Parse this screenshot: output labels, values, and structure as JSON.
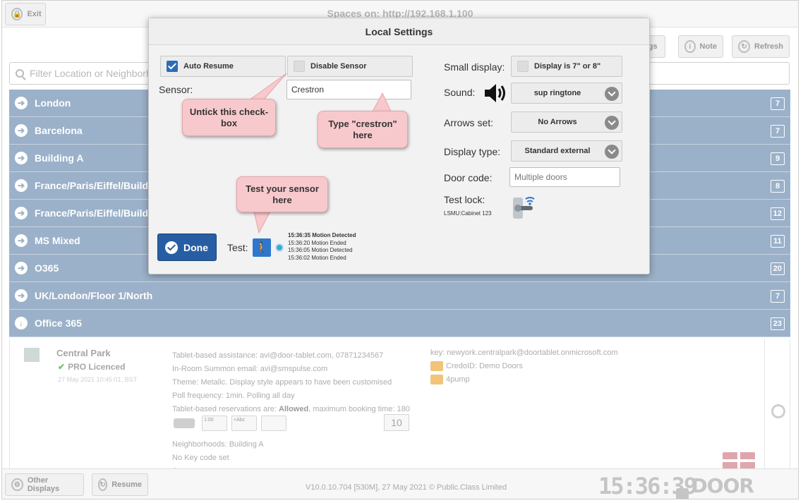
{
  "topbar": {
    "exit_label": "Exit",
    "title": "Spaces on: http://192.168.1.100",
    "settings_label": "ngs",
    "note_label": "Note",
    "refresh_label": "Refresh"
  },
  "filter": {
    "placeholder": "Filter Location or Neighborh"
  },
  "locations": [
    {
      "name": "London",
      "count": "7"
    },
    {
      "name": "Barcelona",
      "count": "7"
    },
    {
      "name": "Building A",
      "count": "9"
    },
    {
      "name": "France/Paris/Eiffel/Buildi",
      "count": "8"
    },
    {
      "name": "France/Paris/Eiffel/Buildi",
      "count": "12"
    },
    {
      "name": "MS Mixed",
      "count": "11"
    },
    {
      "name": "O365",
      "count": "20"
    },
    {
      "name": "UK/London/Floor 1/North",
      "count": "7"
    },
    {
      "name": "Office 365",
      "count": "23"
    }
  ],
  "detail": {
    "name": "Central Park",
    "licence": "PRO Licenced",
    "timestamp": "27 May 2021 10:45:01, BST",
    "line1": "Tablet-based assistance: avi@door-tablet.com, 07871234567",
    "line2": "In-Room Summon email: avi@smspulse.com",
    "line3": "Theme: Metalic. Display style appears to have been customised",
    "line4": "Poll frequency: 1min. Polling all day",
    "line5_prefix": "Tablet-based reservations are: ",
    "line5_bold": "Allowed",
    "line5_suffix": ", maximum booking time: 180",
    "key": "key: newyork.centralpark@doortablet.onmicrosoft.com",
    "credo": "CredoID: Demo Doors",
    "pump": "4pump",
    "dev2": "1:00",
    "dev3": "+Abc",
    "capacity": "10",
    "neighborhoods": "Neighborhoods: Building A",
    "keycode": "No Key code set",
    "cut": "Crestron"
  },
  "bottombar": {
    "other_displays": "Other Displays",
    "resume": "Resume",
    "version": "V10.0.10.704 [530M], 27 May 2021 © Public.Class Limited",
    "clock": "15:36:39",
    "brand": "DOOR TABLET"
  },
  "modal": {
    "title": "Local Settings",
    "auto_resume": "Auto Resume",
    "disable_sensor": "Disable Sensor",
    "sensor_label": "Sensor:",
    "sensor_value": "Crestron",
    "small_display_label": "Small display:",
    "small_display_option": "Display is 7\" or 8\"",
    "sound_label": "Sound:",
    "sound_value": "sup ringtone",
    "arrows_label": "Arrows set:",
    "arrows_value": "No Arrows",
    "display_type_label": "Display type:",
    "display_type_value": "Standard external",
    "door_code_label": "Door code:",
    "door_code_placeholder": "Multiple doors",
    "test_lock_label": "Test lock:",
    "test_lock_sub": "LSMU:Cabinet 123",
    "done_label": "Done",
    "test_label": "Test:",
    "log": [
      "15:36:35 Motion Detected",
      "15:36:20 Motion Ended",
      "15:36:05 Motion Detected",
      "15:36:02 Motion Ended"
    ]
  },
  "callouts": {
    "untick": "Untick this check-box",
    "type": "Type \"crestron\" here",
    "test": "Test your sensor here"
  },
  "colors": {
    "location_row": "#9bb1c9",
    "done_button": "#275ea3",
    "callout": "#f8c9cc",
    "checkbox_on": "#2b6cb8"
  }
}
